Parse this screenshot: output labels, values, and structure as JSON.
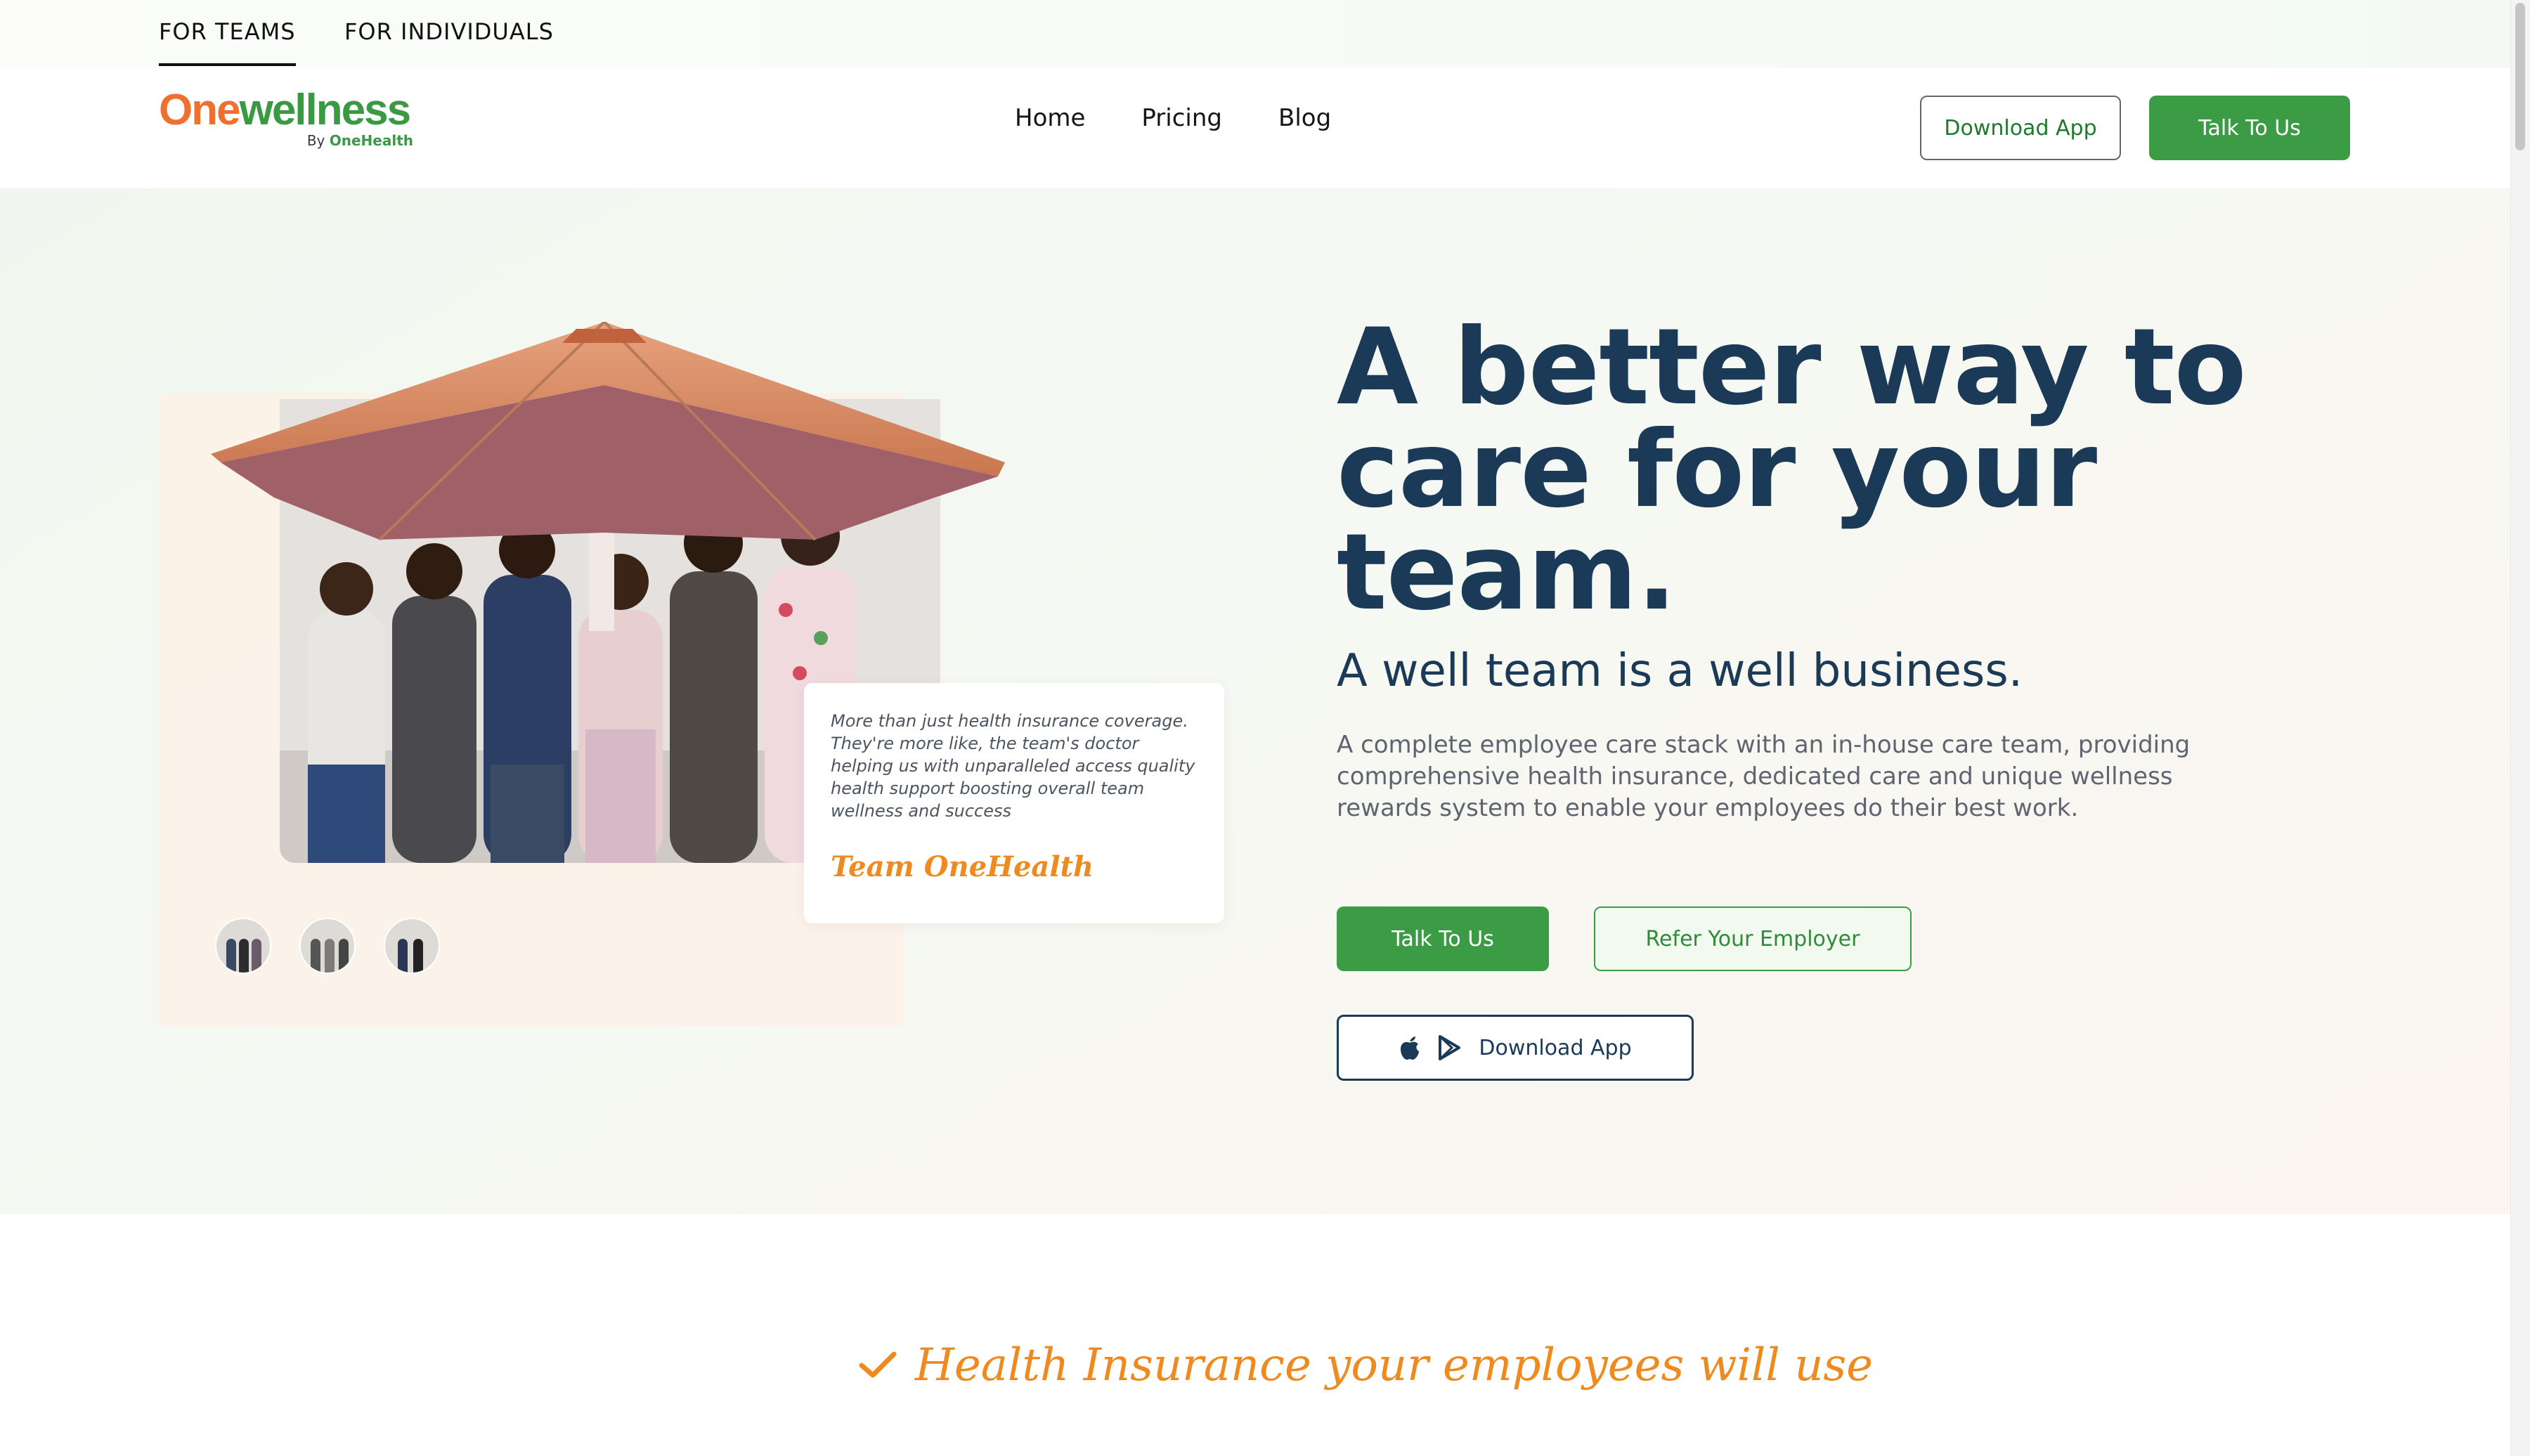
{
  "audience_tabs": [
    {
      "label": "FOR TEAMS",
      "active": true
    },
    {
      "label": "FOR INDIVIDUALS",
      "active": false
    }
  ],
  "logo": {
    "one": "One",
    "wellness": "wellness",
    "by": "By",
    "parent": "OneHealth"
  },
  "nav": {
    "home": "Home",
    "pricing": "Pricing",
    "blog": "Blog"
  },
  "header_buttons": {
    "download": "Download App",
    "talk": "Talk To Us"
  },
  "hero": {
    "title": "A better way to care for your team.",
    "subtitle": "A well team is a well business.",
    "description": "A complete employee care stack with an in-house care team, providing comprehensive health insurance, dedicated care and unique wellness rewards system to enable your employees do their best work.",
    "cta_talk": "Talk To Us",
    "cta_refer": "Refer Your Employer",
    "cta_download": "Download App"
  },
  "testimonial": {
    "quote": "More than just health insurance coverage. They're more like, the team's doctor helping us with unparalleled access quality health support boosting overall team wellness and success",
    "author": "Team OneHealth"
  },
  "section": {
    "tagline": "Health Insurance your employees will use"
  },
  "colors": {
    "brand_green": "#3b9c45",
    "brand_orange": "#ef6f2e",
    "navy": "#1b3a57",
    "accent_orange": "#ef8a1f"
  },
  "icons": [
    "apple-icon",
    "google-play-icon",
    "check-icon"
  ]
}
